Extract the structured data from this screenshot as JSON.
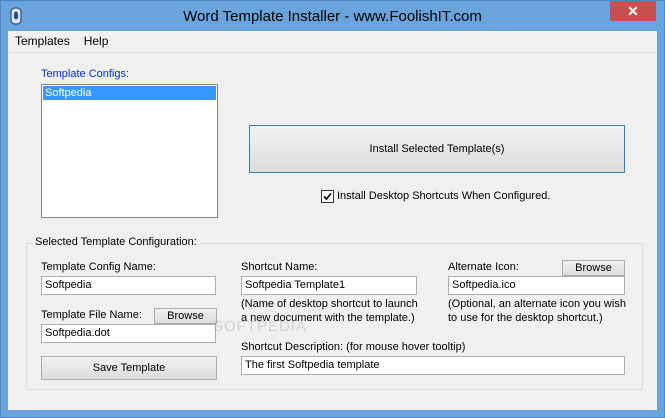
{
  "window": {
    "title": "Word Template Installer  -  www.FoolishIT.com",
    "close_label": "✕"
  },
  "menu": [
    "Templates",
    "Help"
  ],
  "configs": {
    "label": "Template Configs:",
    "items": [
      "Softpedia"
    ],
    "selected": "Softpedia"
  },
  "install": {
    "button_label": "Install Selected Template(s)",
    "shortcut_checkbox_label": "Install Desktop Shortcuts When Configured.",
    "shortcut_checked": true
  },
  "selected_config": {
    "group_title": "Selected Template Configuration:",
    "config_name_label": "Template Config Name:",
    "config_name_value": "Softpedia",
    "file_name_label": "Template File Name:",
    "file_browse_label": "Browse",
    "file_name_value": "Softpedia.dot",
    "save_label": "Save Template",
    "shortcut_name_label": "Shortcut Name:",
    "shortcut_name_value": "Softpedia Template1",
    "shortcut_name_hint_1": "(Name of desktop shortcut to launch",
    "shortcut_name_hint_2": "a new document with the template.)",
    "shortcut_desc_label": "Shortcut Description:  (for mouse hover tooltip)",
    "shortcut_desc_value": "The first Softpedia template",
    "alt_icon_label": "Alternate Icon:",
    "alt_icon_browse_label": "Browse",
    "alt_icon_value": "Softpedia.ico",
    "alt_icon_hint_1": "(Optional, an alternate icon you wish",
    "alt_icon_hint_2": "to use for the desktop shortcut.)"
  },
  "watermark": "SOFTPEDIA",
  "icons": {
    "app": "app-icon",
    "check": "check-icon"
  }
}
